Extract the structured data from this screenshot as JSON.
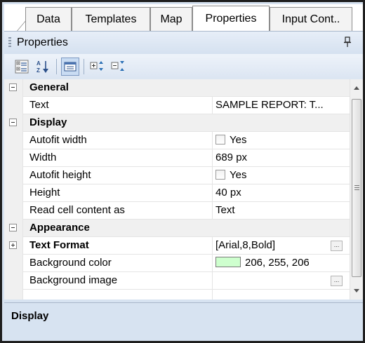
{
  "tabs": [
    {
      "label": "Data",
      "active": false
    },
    {
      "label": "Templates",
      "active": false
    },
    {
      "label": "Map",
      "active": false
    },
    {
      "label": "Properties",
      "active": true
    },
    {
      "label": "Input Cont..",
      "active": false
    }
  ],
  "panel": {
    "title": "Properties",
    "pin_icon": "pin-icon"
  },
  "toolbar": {
    "buttons": [
      {
        "icon": "categorized-view-icon",
        "pressed": false
      },
      {
        "icon": "alphabetical-sort-icon",
        "pressed": false
      },
      {
        "icon": "property-pages-icon",
        "pressed": true
      },
      {
        "icon": "expand-all-icon",
        "pressed": false
      },
      {
        "icon": "collapse-all-icon",
        "pressed": false
      }
    ]
  },
  "grid": {
    "general": {
      "label": "General"
    },
    "text": {
      "label": "Text",
      "value": "SAMPLE REPORT:  T..."
    },
    "display": {
      "label": "Display"
    },
    "autofit_width": {
      "label": "Autofit width",
      "value": "Yes",
      "checked": false
    },
    "width": {
      "label": "Width",
      "value": "689 px"
    },
    "autofit_height": {
      "label": "Autofit height",
      "value": "Yes",
      "checked": false
    },
    "height": {
      "label": "Height",
      "value": "40 px"
    },
    "read_cell": {
      "label": "Read cell content as",
      "value": "Text"
    },
    "appearance": {
      "label": "Appearance"
    },
    "text_format": {
      "label": "Text Format",
      "value": "[Arial,8,Bold]",
      "button": "..."
    },
    "background_color": {
      "label": "Background color",
      "value": "206, 255, 206",
      "swatch": "#ceffce"
    },
    "background_image": {
      "label": "Background image",
      "button": "..."
    }
  },
  "description": {
    "title": "Display"
  },
  "colors": {
    "panel_bg": "#d7e3f1",
    "category_bg": "#f0f0f0",
    "grid_line": "#e4e4e4"
  }
}
